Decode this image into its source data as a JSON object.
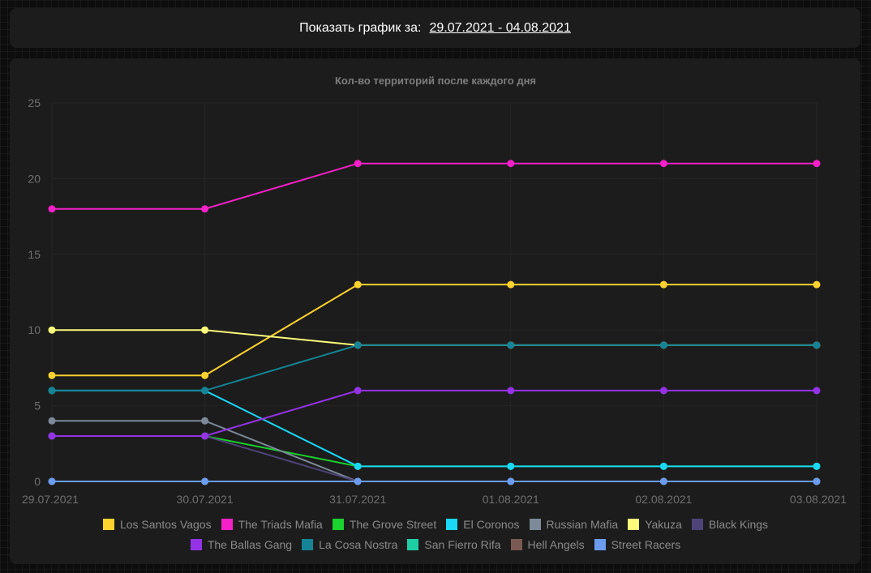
{
  "header": {
    "label": "Показать график за:",
    "date_range": "29.07.2021 - 04.08.2021"
  },
  "chart_data": {
    "type": "line",
    "title": "Кол-во территорий после каждого дня",
    "xlabel": "",
    "ylabel": "",
    "categories": [
      "29.07.2021",
      "30.07.2021",
      "31.07.2021",
      "01.08.2021",
      "02.08.2021",
      "03.08.2021"
    ],
    "ylim": [
      0,
      25
    ],
    "yticks": [
      0,
      5,
      10,
      15,
      20,
      25
    ],
    "grid": true,
    "legend_position": "bottom",
    "series": [
      {
        "name": "Los Santos Vagos",
        "color": "#fdd22e",
        "values": [
          7,
          7,
          13,
          13,
          13,
          13
        ]
      },
      {
        "name": "The Triads Mafia",
        "color": "#f520c8",
        "values": [
          18,
          18,
          21,
          21,
          21,
          21
        ]
      },
      {
        "name": "The Grove Street",
        "color": "#1ad12d",
        "values": [
          3,
          3,
          1,
          1,
          1,
          1
        ]
      },
      {
        "name": "El Coronos",
        "color": "#19d8f8",
        "values": [
          6,
          6,
          1,
          1,
          1,
          1
        ]
      },
      {
        "name": "Russian Mafia",
        "color": "#7c8a99",
        "values": [
          4,
          4,
          0,
          0,
          0,
          0
        ]
      },
      {
        "name": "Yakuza",
        "color": "#fdfb7a",
        "values": [
          10,
          10,
          9,
          9,
          9,
          9
        ]
      },
      {
        "name": "Black Kings",
        "color": "#4e4378",
        "values": [
          3,
          3,
          0,
          0,
          0,
          0
        ]
      },
      {
        "name": "The Ballas Gang",
        "color": "#9433e6",
        "values": [
          3,
          3,
          6,
          6,
          6,
          6
        ]
      },
      {
        "name": "La Cosa Nostra",
        "color": "#148496",
        "values": [
          6,
          6,
          9,
          9,
          9,
          9
        ]
      },
      {
        "name": "San Fierro Rifa",
        "color": "#1fcfa4",
        "values": [
          0,
          0,
          0,
          0,
          0,
          0
        ]
      },
      {
        "name": "Hell Angels",
        "color": "#7a5a52",
        "values": [
          0,
          0,
          0,
          0,
          0,
          0
        ]
      },
      {
        "name": "Street Racers",
        "color": "#6b9cf0",
        "values": [
          0,
          0,
          0,
          0,
          0,
          0
        ]
      }
    ],
    "legend_rows": [
      [
        0,
        1,
        2,
        3,
        4,
        5,
        6
      ],
      [
        7,
        8,
        9,
        10,
        11
      ]
    ]
  }
}
